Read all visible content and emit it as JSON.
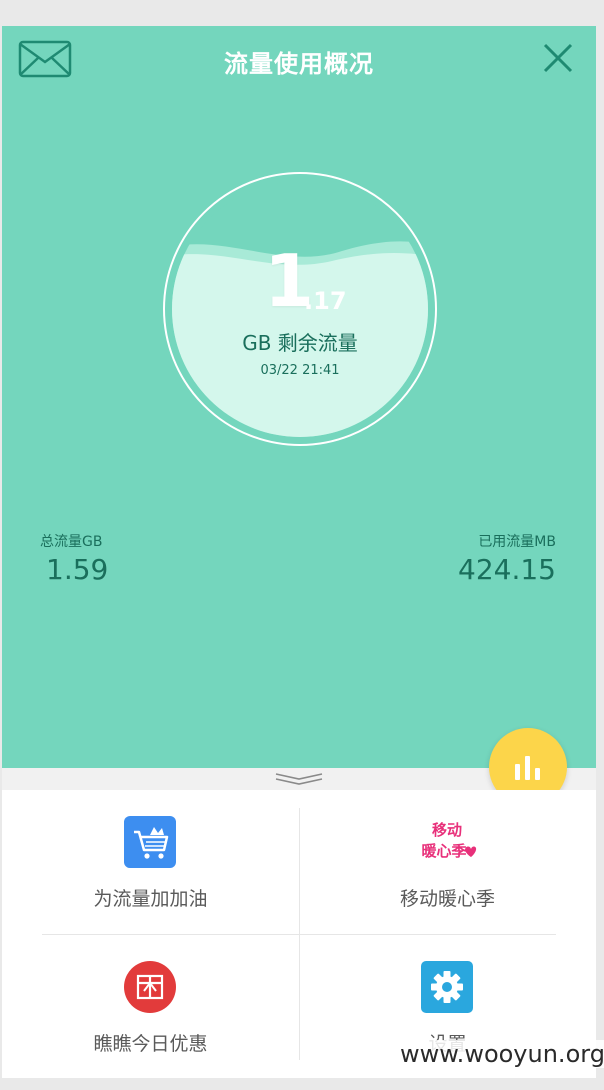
{
  "header": {
    "title": "流量使用概况",
    "mail_icon": "mail-icon",
    "close_icon": "close-icon"
  },
  "gauge": {
    "integer": "1",
    "decimal": ".17",
    "label": "GB 剩余流量",
    "timestamp": "03/22 21:41",
    "fill_level": 0.72
  },
  "stats": {
    "total_label": "总流量GB",
    "total_value": "1.59",
    "used_label": "已用流量MB",
    "used_value": "424.15"
  },
  "fab": {
    "icon": "bar-chart-icon"
  },
  "grid": {
    "items": [
      {
        "label": "为流量加加油",
        "icon": "shopping-cart-icon",
        "color": "#3d8ef0"
      },
      {
        "label": "移动暖心季",
        "icon": "promo-logo-icon",
        "color": "#e8307a"
      },
      {
        "label": "瞧瞧今日优惠",
        "icon": "gift-icon",
        "color": "#e23b3b"
      },
      {
        "label": "设置",
        "icon": "gear-icon",
        "color": "#2aa7de"
      }
    ]
  },
  "promo_logo": {
    "line1": "移动",
    "line2": "暖心季"
  },
  "watermark": "www.wooyun.org",
  "colors": {
    "hero_bg": "#74d6bd",
    "accent_dark": "#1a6f5c",
    "fab": "#fcd54a"
  }
}
